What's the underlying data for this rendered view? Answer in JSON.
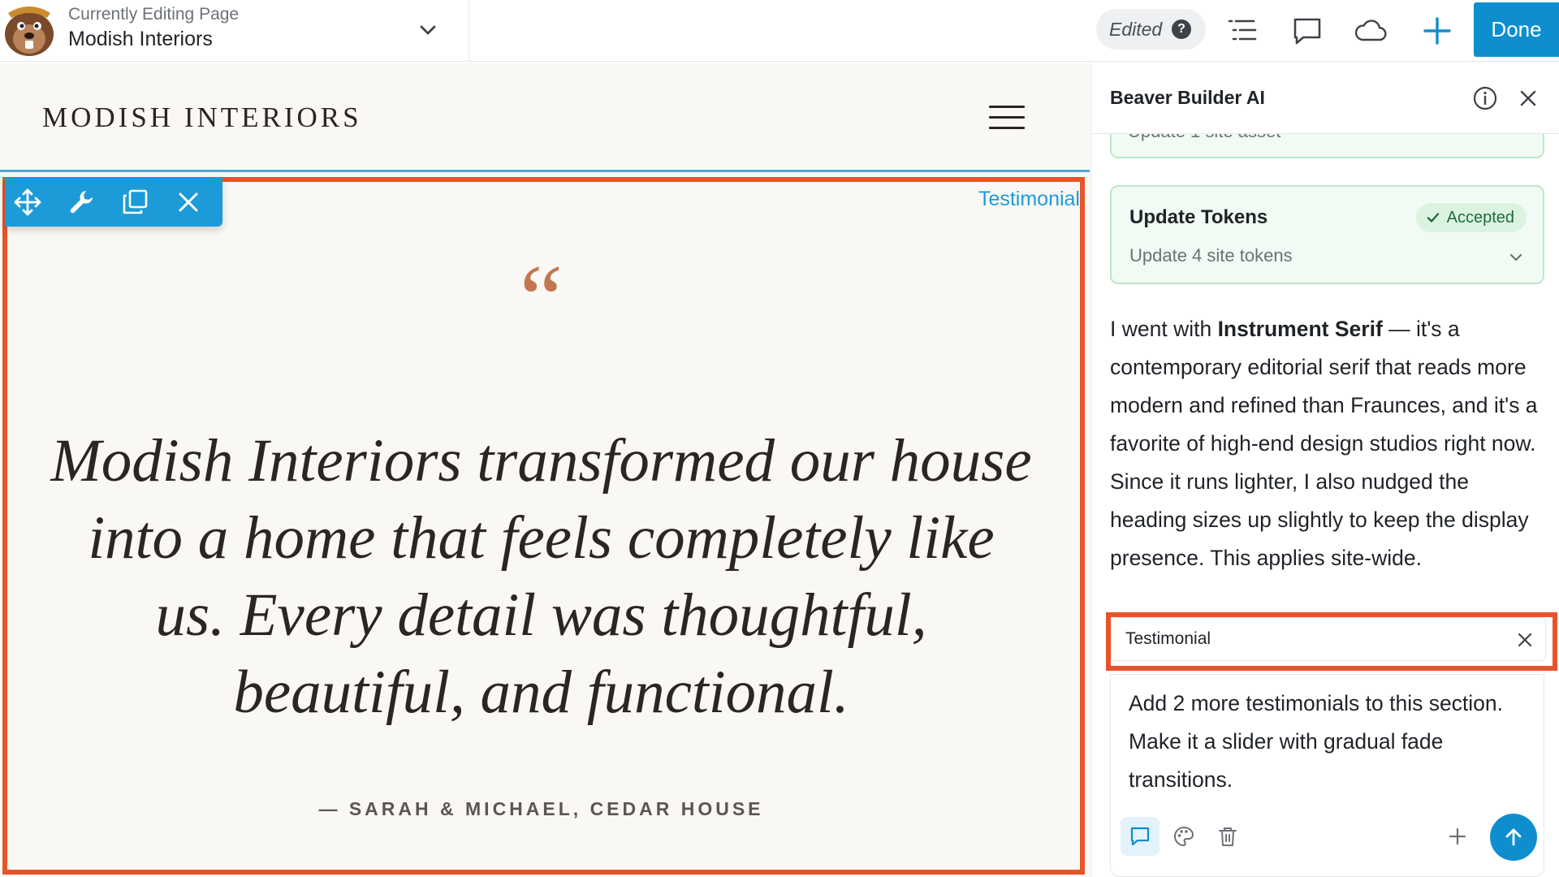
{
  "topbar": {
    "editing_label": "Currently Editing Page",
    "page_title": "Modish Interiors",
    "status": "Edited",
    "status_help": "?",
    "done_label": "Done"
  },
  "site": {
    "logo_text": "MODISH INTERIORS"
  },
  "testimonial": {
    "module_label": "Testimonial",
    "quote_mark": "“",
    "quote": "Modish Interiors transformed our house into a home that feels completely like us. Every detail was thoughtful, beautiful, and functional.",
    "attribution": "— SARAH & MICHAEL, CEDAR HOUSE",
    "accent_color": "#c27751",
    "selection_color": "#e8542a"
  },
  "panel": {
    "title": "Beaver Builder AI",
    "previous_card_text": "Update 1 site asset",
    "token_card": {
      "title": "Update Tokens",
      "badge": "Accepted",
      "subtitle": "Update 4 site tokens"
    },
    "message": {
      "p1": "I went with ",
      "bold": "Instrument Serif",
      "p2": " — it's a contemporary editorial serif that reads more modern and refined than Fraunces, and it's a favorite of high-end design studios right now. Since it runs lighter, I also nudged the heading sizes up slightly to keep the display presence. This applies site-wide."
    },
    "context_chip": "Testimonial",
    "composer_text": "Add 2 more testimonials to this section. Make it a slider with gradual fade transitions."
  },
  "colors": {
    "brand_blue": "#0f8ecf",
    "accepted_green": "#1e6b3a"
  }
}
